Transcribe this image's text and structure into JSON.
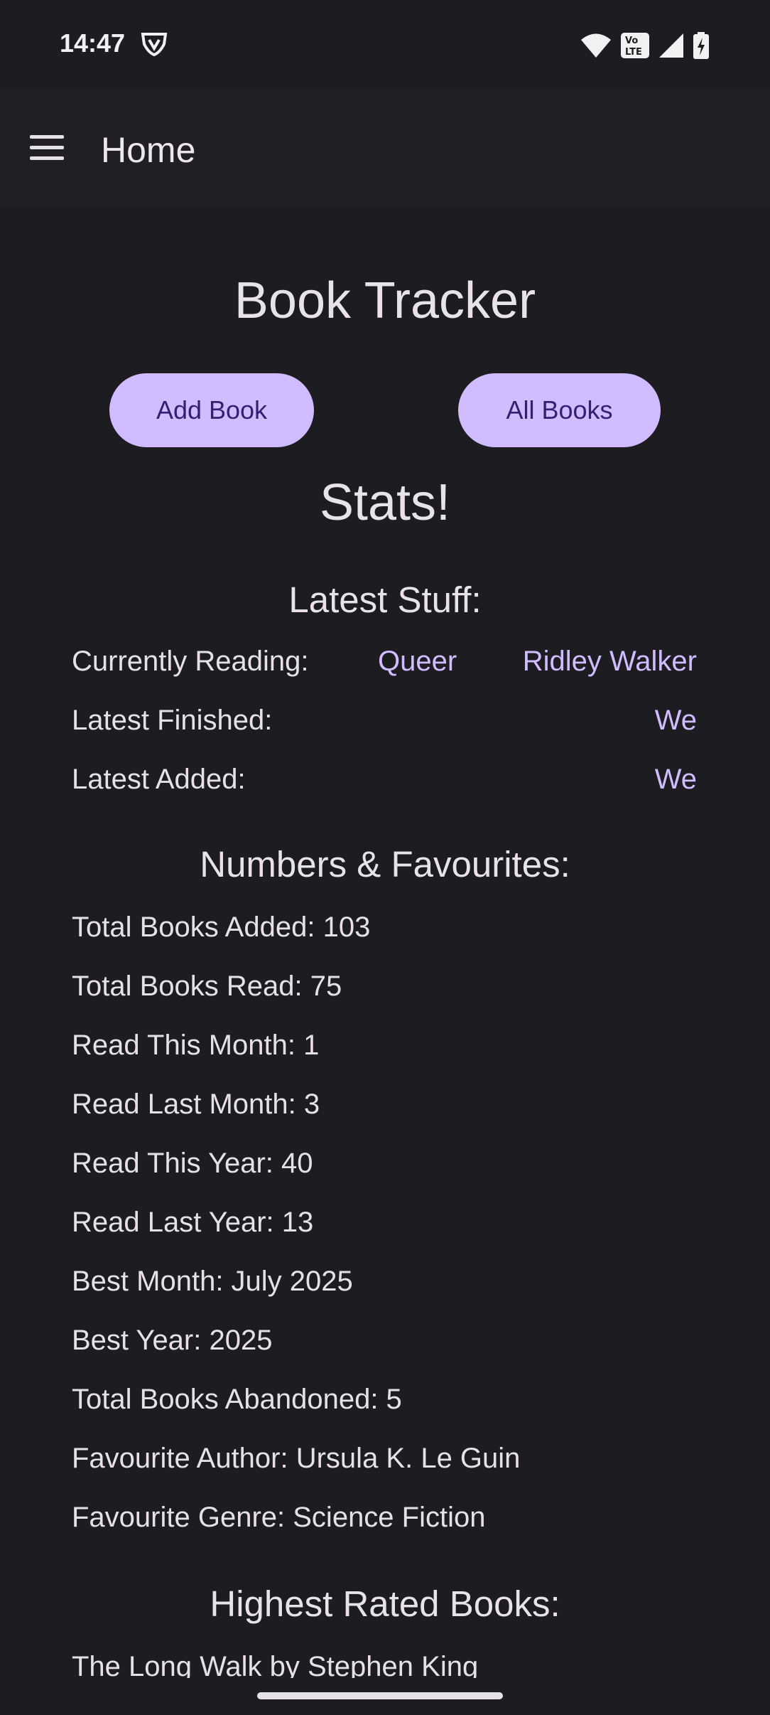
{
  "status_bar": {
    "time": "14:47",
    "icons": [
      "vpn-shield-icon",
      "wifi-icon",
      "volte-icon",
      "signal-icon",
      "battery-charging-icon"
    ],
    "volte_label_top": "Vo",
    "volte_label_bottom": "LTE"
  },
  "app_bar": {
    "menu_icon": "hamburger-menu-icon",
    "title": "Home"
  },
  "main": {
    "title": "Book Tracker",
    "buttons": {
      "add_book": "Add Book",
      "all_books": "All Books"
    },
    "stats_title": "Stats!",
    "latest": {
      "heading": "Latest Stuff:",
      "currently_reading_label": "Currently Reading:",
      "currently_reading_books": [
        "Queer",
        "Ridley Walker"
      ],
      "latest_finished_label": "Latest Finished:",
      "latest_finished_book": "We",
      "latest_added_label": "Latest Added:",
      "latest_added_book": "We"
    },
    "numbers": {
      "heading": "Numbers & Favourites:",
      "lines": [
        "Total Books Added: 103",
        "Total Books Read: 75",
        "Read This Month: 1",
        "Read Last Month: 3",
        "Read This Year: 40",
        "Read Last Year: 13",
        "Best Month: July 2025",
        "Best Year: 2025",
        "Total Books Abandoned: 5",
        "Favourite Author: Ursula K. Le Guin",
        "Favourite Genre: Science Fiction"
      ]
    },
    "highest_rated": {
      "heading": "Highest Rated Books:",
      "books": [
        "The Long Walk by Stephen King"
      ]
    }
  },
  "colors": {
    "background": "#1d1c20",
    "app_bar": "#211f24",
    "accent": "#d0bcff",
    "button_text": "#381e72",
    "text": "#e6e1e6"
  }
}
